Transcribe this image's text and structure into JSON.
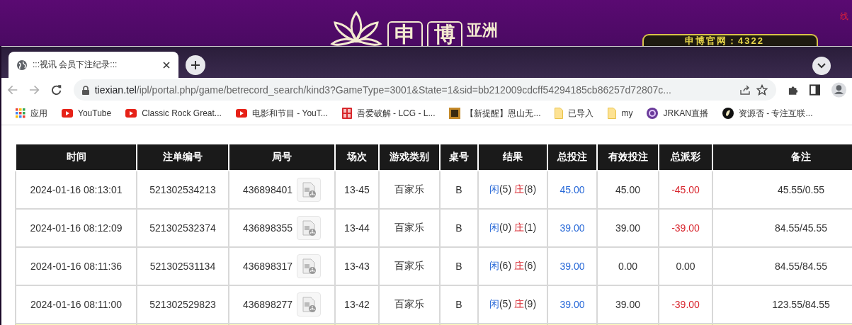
{
  "backdrop_site": {
    "logo_chars": [
      "申",
      "博"
    ],
    "logo_suffix": "亚洲",
    "banner": "申博官网：4322",
    "corner_link": "线"
  },
  "browser": {
    "tabs": [
      {
        "title": ":::视讯 会员下注纪录:::",
        "selected": true
      }
    ],
    "url": {
      "host": "tiexian.tel",
      "path": "/ipl/portal.php/game/betrecord_search/kind3?GameType=3001&State=1&sid=bb212009cdcff54294185cb86257d72807c..."
    },
    "bookmarks": [
      {
        "kind": "apps",
        "label": "应用"
      },
      {
        "kind": "youtube",
        "label": "YouTube"
      },
      {
        "kind": "youtube",
        "label": "Classic Rock Great..."
      },
      {
        "kind": "youtube",
        "label": "电影和节目 - YouT..."
      },
      {
        "kind": "seal",
        "label": "吾爱破解 - LCG - L..."
      },
      {
        "kind": "square",
        "label": "【新提醒】恩山无..."
      },
      {
        "kind": "folder",
        "label": "已导入"
      },
      {
        "kind": "folder",
        "label": "my"
      },
      {
        "kind": "orb",
        "label": "JRKAN直播"
      },
      {
        "kind": "badge",
        "label": "资源否 - 专注互联..."
      }
    ]
  },
  "table": {
    "columns": [
      "时间",
      "注单编号",
      "局号",
      "场次",
      "游戏类别",
      "桌号",
      "结果",
      "总投注",
      "有效投注",
      "总派彩",
      "备注"
    ],
    "rows": [
      {
        "time": "2024-01-16 08:13:01",
        "bet_id": "521302534213",
        "round": "436898401",
        "session": "13-45",
        "game": "百家乐",
        "table": "B",
        "player": "闲",
        "player_score": "(5)",
        "banker": "庄",
        "banker_score": "(8)",
        "total_bet": "45.00",
        "valid_bet": "45.00",
        "payout": "-45.00",
        "loss": true,
        "note": "45.55/0.55"
      },
      {
        "time": "2024-01-16 08:12:09",
        "bet_id": "521302532374",
        "round": "436898355",
        "session": "13-44",
        "game": "百家乐",
        "table": "B",
        "player": "闲",
        "player_score": "(0)",
        "banker": "庄",
        "banker_score": "(1)",
        "total_bet": "39.00",
        "valid_bet": "39.00",
        "payout": "-39.00",
        "loss": true,
        "note": "84.55/45.55"
      },
      {
        "time": "2024-01-16 08:11:36",
        "bet_id": "521302531134",
        "round": "436898317",
        "session": "13-43",
        "game": "百家乐",
        "table": "B",
        "player": "闲",
        "player_score": "(6)",
        "banker": "庄",
        "banker_score": "(6)",
        "total_bet": "39.00",
        "valid_bet": "0.00",
        "payout": "0.00",
        "loss": false,
        "note": "84.55/84.55"
      },
      {
        "time": "2024-01-16 08:11:00",
        "bet_id": "521302529823",
        "round": "436898277",
        "session": "13-42",
        "game": "百家乐",
        "table": "B",
        "player": "闲",
        "player_score": "(5)",
        "banker": "庄",
        "banker_score": "(9)",
        "total_bet": "39.00",
        "valid_bet": "39.00",
        "payout": "-39.00",
        "loss": true,
        "note": "123.55/84.55"
      }
    ]
  }
}
